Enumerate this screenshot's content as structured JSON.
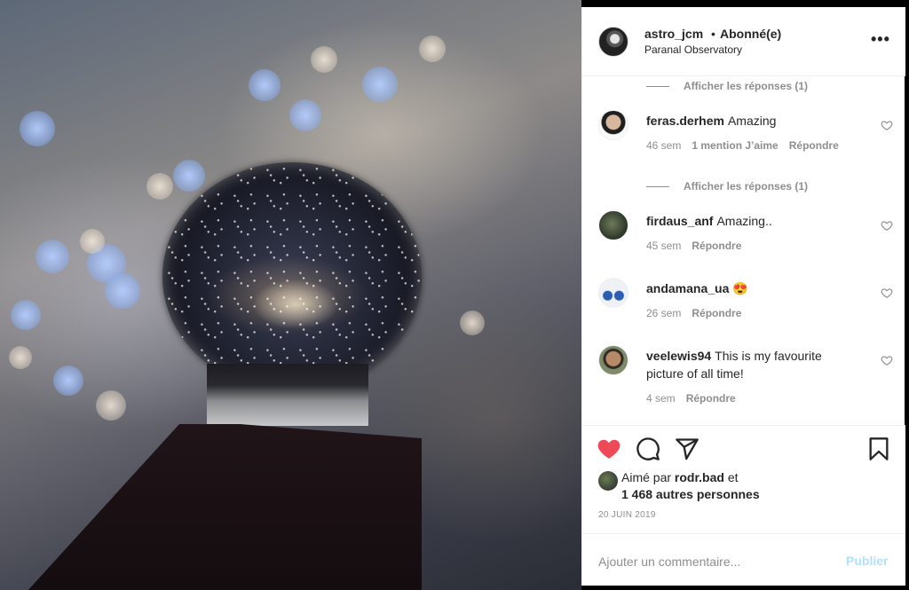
{
  "header": {
    "username": "astro_jcm",
    "separator": "•",
    "follow_status": "Abonné(e)",
    "location": "Paranal Observatory",
    "more_icon": "more-horizontal-icon"
  },
  "view_replies": [
    {
      "label": "Afficher les réponses (1)"
    },
    {
      "label": "Afficher les réponses (1)"
    }
  ],
  "comments": [
    {
      "username": "feras.derhem",
      "text": "Amazing",
      "time": "46 sem",
      "likes": "1 mention J’aime",
      "reply": "Répondre"
    },
    {
      "username": "firdaus_anf",
      "text": "Amazing..",
      "time": "45 sem",
      "reply": "Répondre"
    },
    {
      "username": "andamana_ua",
      "text": "😍",
      "time": "26 sem",
      "reply": "Répondre"
    },
    {
      "username": "veelewis94",
      "text": "This is my favourite picture of all time!",
      "time": "4 sem",
      "reply": "Répondre"
    }
  ],
  "actions": {
    "like_icon": "heart-filled-icon",
    "comment_icon": "comment-icon",
    "share_icon": "share-icon",
    "save_icon": "bookmark-icon",
    "like_color": "#ed4956"
  },
  "likes": {
    "prefix": "Aimé par",
    "user": "rodr.bad",
    "and": "et",
    "others": "1 468 autres personnes"
  },
  "post_date": "20 JUIN 2019",
  "add_comment": {
    "placeholder": "Ajouter un commentaire...",
    "publish_label": "Publier",
    "publish_color": "#b2dffc"
  }
}
